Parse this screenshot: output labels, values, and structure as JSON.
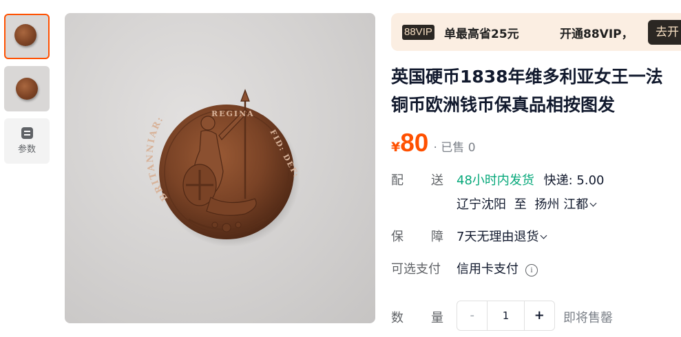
{
  "gallery": {
    "thumbnails": [
      {
        "name": "coin-front-thumbnail",
        "selected": true
      },
      {
        "name": "coin-back-thumbnail",
        "selected": false
      }
    ],
    "params_label": "参数",
    "coin_legend_top": "REGINA",
    "coin_legend_left": "BRITANNIAR:",
    "coin_legend_right": "FID: DEF:"
  },
  "vip": {
    "badge": "88VIP",
    "promo_text": "单最高省25元",
    "open_text": "开通88VIP，",
    "button_label": "去开"
  },
  "product": {
    "title_line1": "英国硬币1838年维多利亚女王一法",
    "title_line2": "铜币欧洲钱币保真品相按图发",
    "currency": "¥",
    "price": "80",
    "sold": "· 已售 0"
  },
  "delivery": {
    "label_a": "配",
    "label_b": "送",
    "dispatch": "48小时内发货",
    "shipping": "快递: 5.00",
    "from": "辽宁沈阳",
    "to_word": "至",
    "to": "扬州 江都"
  },
  "guarantee": {
    "label_a": "保",
    "label_b": "障",
    "value": "7天无理由退货"
  },
  "payment": {
    "label": "可选支付",
    "value": "信用卡支付",
    "info_glyph": "i"
  },
  "quantity": {
    "label_a": "数",
    "label_b": "量",
    "minus": "-",
    "value": "1",
    "plus": "+",
    "stock_status": "即将售罄"
  },
  "colors": {
    "accent": "#ff5000",
    "green": "#06a87a",
    "vip_bg": "#fbeee2",
    "vip_dark": "#2b2723"
  }
}
